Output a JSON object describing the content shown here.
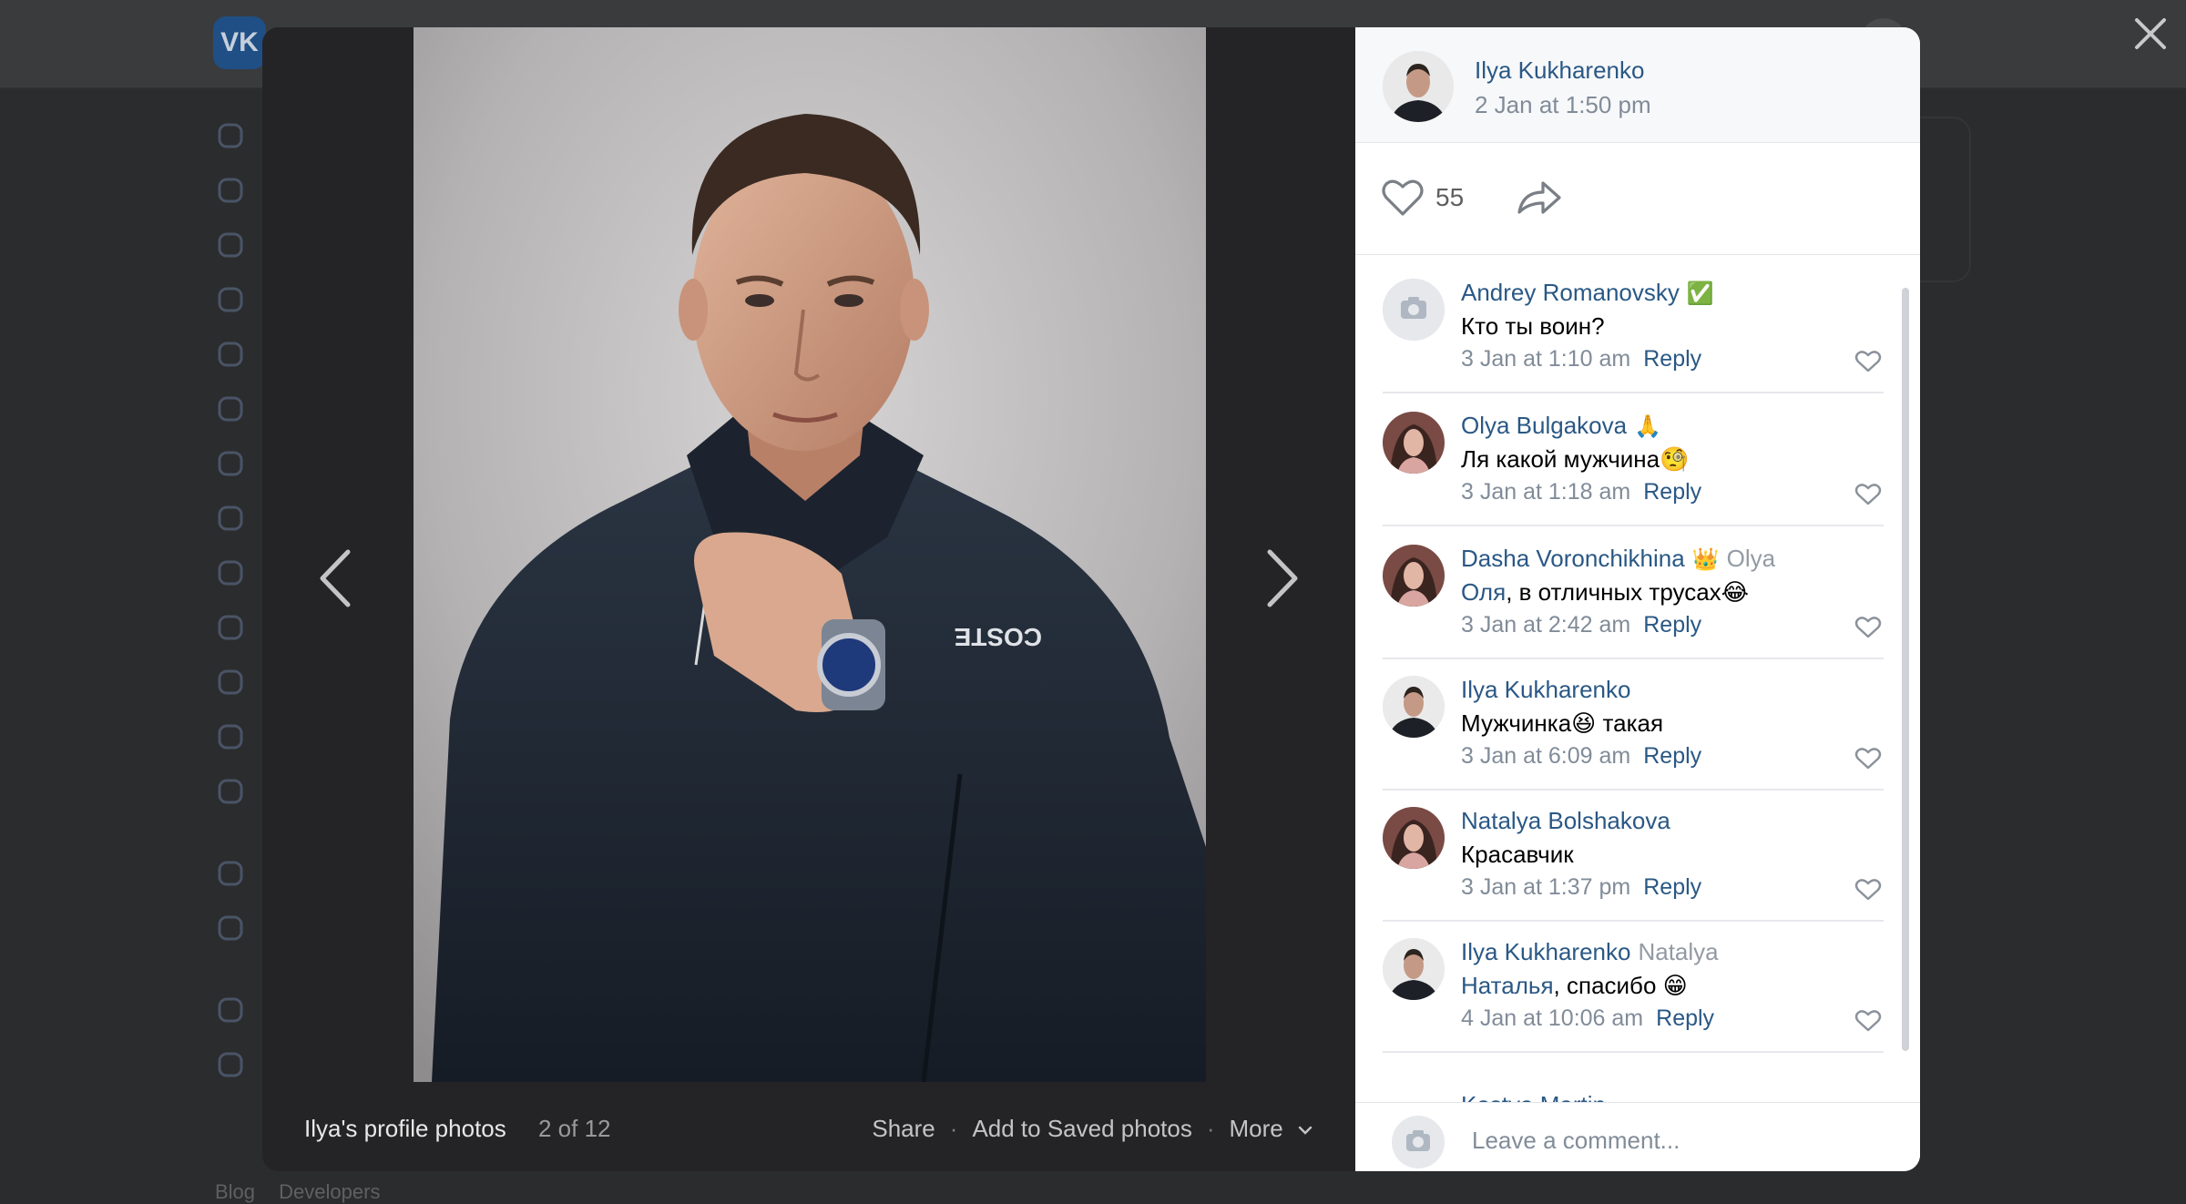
{
  "background": {
    "logo_text": "VK",
    "footer_links": [
      "Blog",
      "Developers"
    ],
    "sidebar_icons": [
      "profile-icon",
      "news-icon",
      "messages-icon",
      "calls-icon",
      "friends-icon",
      "communities-icon",
      "photos-icon",
      "music-icon",
      "video-icon",
      "clips-icon",
      "games-icon",
      "stickers-icon",
      "gifts-icon",
      "apps-icon",
      "payments-icon",
      "bookmarks-icon",
      "ads-icon"
    ]
  },
  "viewer": {
    "album_title": "Ilya's profile photos",
    "counter": "2 of 12",
    "actions": {
      "share": "Share",
      "separator": "·",
      "save": "Add to Saved photos",
      "more": "More"
    },
    "photo_shirt_text": "COSTE"
  },
  "post": {
    "author": "Ilya Kukharenko",
    "date": "2 Jan at 1:50 pm",
    "likes": "55"
  },
  "comments": [
    {
      "name": "Andrey Romanovsky",
      "badge": "✅",
      "mention_name": "",
      "mention": "",
      "text": "Кто ты воин?",
      "date": "3 Jan at 1:10 am",
      "reply": "Reply",
      "avatar": "camera-placeholder"
    },
    {
      "name": "Olya Bulgakova",
      "badge": "🙏",
      "mention_name": "",
      "mention": "",
      "text": "Ля какой мужчина🧐",
      "date": "3 Jan at 1:18 am",
      "reply": "Reply",
      "avatar": "woman-photo"
    },
    {
      "name": "Dasha Voronchikhina",
      "badge": "👑",
      "mention_name": "Olya",
      "mention": "Оля",
      "text": ", в отличных трусах😂",
      "date": "3 Jan at 2:42 am",
      "reply": "Reply",
      "avatar": "woman-photo"
    },
    {
      "name": "Ilya Kukharenko",
      "badge": "",
      "mention_name": "",
      "mention": "",
      "text": "Мужчинка😆 такая",
      "date": "3 Jan at 6:09 am",
      "reply": "Reply",
      "avatar": "man-photo"
    },
    {
      "name": "Natalya Bolshakova",
      "badge": "",
      "mention_name": "",
      "mention": "",
      "text": "Красавчик",
      "date": "3 Jan at 1:37 pm",
      "reply": "Reply",
      "avatar": "woman-photo"
    },
    {
      "name": "Ilya Kukharenko",
      "badge": "",
      "mention_name": "Natalya",
      "mention": "Наталья",
      "text": ", спасибо 😁",
      "date": "4 Jan at 10:06 am",
      "reply": "Reply",
      "avatar": "man-photo"
    }
  ],
  "partial_comment_name": "Kostya Martin",
  "comment_input": {
    "placeholder": "Leave a comment..."
  },
  "colors": {
    "link": "#2a5885",
    "secondary_text": "#818c99",
    "overlay": "#2b2c2e",
    "viewer_bg": "#232325"
  }
}
